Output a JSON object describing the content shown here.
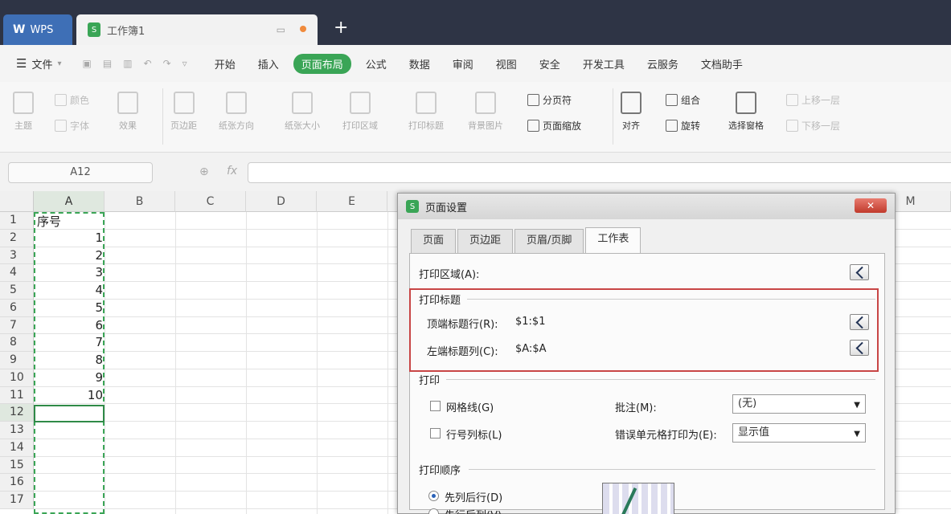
{
  "titlebar": {
    "app_tab": "WPS",
    "doc_tab": "工作簿1",
    "new_tab": "+"
  },
  "menubar": {
    "file": "文件",
    "items": [
      "开始",
      "插入",
      "页面布局",
      "公式",
      "数据",
      "审阅",
      "视图",
      "安全",
      "开发工具",
      "云服务",
      "文档助手"
    ],
    "active": "页面布局"
  },
  "ribbon": {
    "theme": "主题",
    "color": "颜色",
    "font": "字体",
    "effect": "效果",
    "margins": "页边距",
    "orientation": "纸张方向",
    "size": "纸张大小",
    "print_area": "打印区域",
    "print_titles": "打印标题",
    "bg_image": "背景图片",
    "page_break": "分页符",
    "page_zoom": "页面缩放",
    "align": "对齐",
    "group": "组合",
    "rotate": "旋转",
    "selection_pane": "选择窗格",
    "bring_forward": "上移一层",
    "send_backward": "下移一层"
  },
  "formula_bar": {
    "name_box": "A12",
    "fx": "fx",
    "formula": ""
  },
  "grid": {
    "columns": [
      "A",
      "B",
      "C",
      "D",
      "E",
      "M"
    ],
    "rows": [
      "1",
      "2",
      "3",
      "4",
      "5",
      "6",
      "7",
      "8",
      "9",
      "10",
      "11",
      "12",
      "13",
      "14",
      "15",
      "16",
      "17"
    ],
    "a1": "序号",
    "a_values": [
      "1",
      "2",
      "3",
      "4",
      "5",
      "6",
      "7",
      "8",
      "9",
      "10"
    ],
    "selected_cell": "A12"
  },
  "dialog": {
    "title": "页面设置",
    "close": "✕",
    "tabs": [
      "页面",
      "页边距",
      "页眉/页脚",
      "工作表"
    ],
    "active_tab": "工作表",
    "print_area_label": "打印区域(A):",
    "print_titles_group": "打印标题",
    "top_rows_label": "顶端标题行(R):",
    "top_rows_value": "$1:$1",
    "left_cols_label": "左端标题列(C):",
    "left_cols_value": "$A:$A",
    "print_group": "打印",
    "gridlines": "网格线(G)",
    "row_col_headers": "行号列标(L)",
    "comments_label": "批注(M):",
    "comments_value": "(无)",
    "errors_label": "错误单元格打印为(E):",
    "errors_value": "显示值",
    "order_group": "打印顺序",
    "down_then_over": "先列后行(D)",
    "over_then_down": "先行后列(V)"
  },
  "colors": {
    "accent": "#3aa556",
    "titlebar": "#2e3445",
    "highlight_box": "#c84545"
  }
}
